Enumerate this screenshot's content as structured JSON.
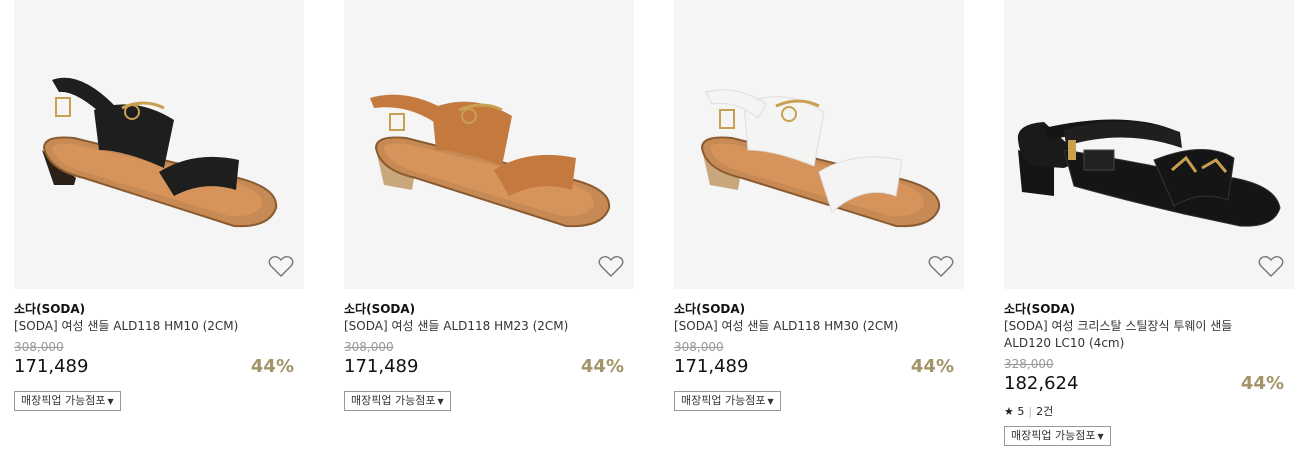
{
  "products": [
    {
      "brand": "소다(SODA)",
      "name": "[SODA] 여성 샌들 ALD118 HM10 (2CM)",
      "original_price": "308,000",
      "price": "171,489",
      "discount": "44%",
      "pickup_label": "매장픽업 가능점포",
      "color": "#1e1e1e"
    },
    {
      "brand": "소다(SODA)",
      "name": "[SODA] 여성 샌들 ALD118 HM23 (2CM)",
      "original_price": "308,000",
      "price": "171,489",
      "discount": "44%",
      "pickup_label": "매장픽업 가능점포",
      "color": "#c47a3f"
    },
    {
      "brand": "소다(SODA)",
      "name": "[SODA] 여성 샌들 ALD118 HM30 (2CM)",
      "original_price": "308,000",
      "price": "171,489",
      "discount": "44%",
      "pickup_label": "매장픽업 가능점포",
      "color": "#f4f4f2"
    },
    {
      "brand": "소다(SODA)",
      "name": "[SODA] 여성 크리스탈 스틸장식 투웨이 샌들 ALD120 LC10 (4cm)",
      "original_price": "328,000",
      "price": "182,624",
      "discount": "44%",
      "rating_star": "★",
      "rating": "5",
      "review_count": "2건",
      "pickup_label": "매장픽업 가능점포",
      "color": "#151515"
    }
  ],
  "icons": {
    "wishlist": "heart-outline-icon",
    "dropdown": "caret-down-icon",
    "rating": "star-icon"
  },
  "colors": {
    "discount": "#a39368",
    "sole": "#c88a55",
    "heel_wood": "#c9a77c"
  }
}
